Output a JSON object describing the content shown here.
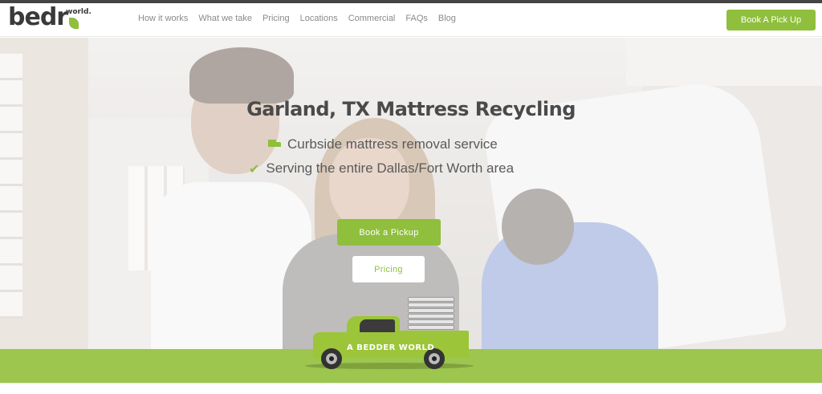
{
  "brand": {
    "logo_main": "bedr",
    "logo_sup": "world."
  },
  "nav": {
    "items": [
      {
        "label": "How it works"
      },
      {
        "label": "What we take"
      },
      {
        "label": "Pricing"
      },
      {
        "label": "Locations"
      },
      {
        "label": "Commercial"
      },
      {
        "label": "FAQs"
      },
      {
        "label": "Blog"
      }
    ],
    "cta_label": "Book A Pick Up"
  },
  "hero": {
    "title": "Garland, TX Mattress Recycling",
    "features": [
      {
        "icon": "truck-icon",
        "text": "Curbside mattress removal service"
      },
      {
        "icon": "check-icon",
        "text": "Serving the entire Dallas/Fort Worth area"
      }
    ],
    "primary_button": "Book a Pickup",
    "secondary_button": "Pricing",
    "truck_label": "A BEDDER WORLD"
  },
  "colors": {
    "accent": "#8fbf3c",
    "band": "#9cc64d",
    "text": "#4a4a4a"
  }
}
